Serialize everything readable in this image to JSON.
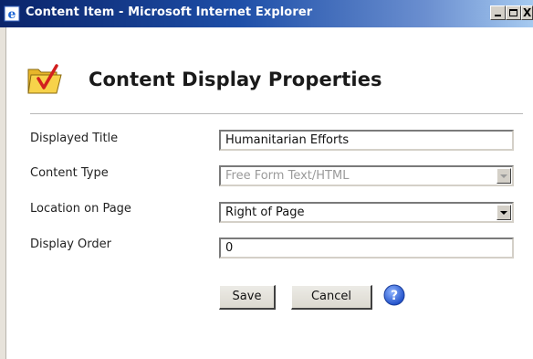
{
  "window": {
    "title": "Content Item - Microsoft Internet Explorer",
    "min_glyph": "_",
    "max_glyph": "□",
    "close_glyph": "X"
  },
  "page": {
    "heading": "Content Display Properties",
    "icon": "folder-checkmark-icon"
  },
  "form": {
    "displayed_title": {
      "label": "Displayed Title",
      "value": "Humanitarian Efforts"
    },
    "content_type": {
      "label": "Content Type",
      "value": "Free Form Text/HTML",
      "disabled": true
    },
    "location_on_page": {
      "label": "Location on Page",
      "value": "Right of Page"
    },
    "display_order": {
      "label": "Display Order",
      "value": "0"
    }
  },
  "buttons": {
    "save": "Save",
    "cancel": "Cancel",
    "help_icon": "help-question-icon"
  },
  "colors": {
    "titlebar_start": "#0a246a",
    "titlebar_end": "#a6caf0",
    "help_blue": "#2a5bd7"
  }
}
